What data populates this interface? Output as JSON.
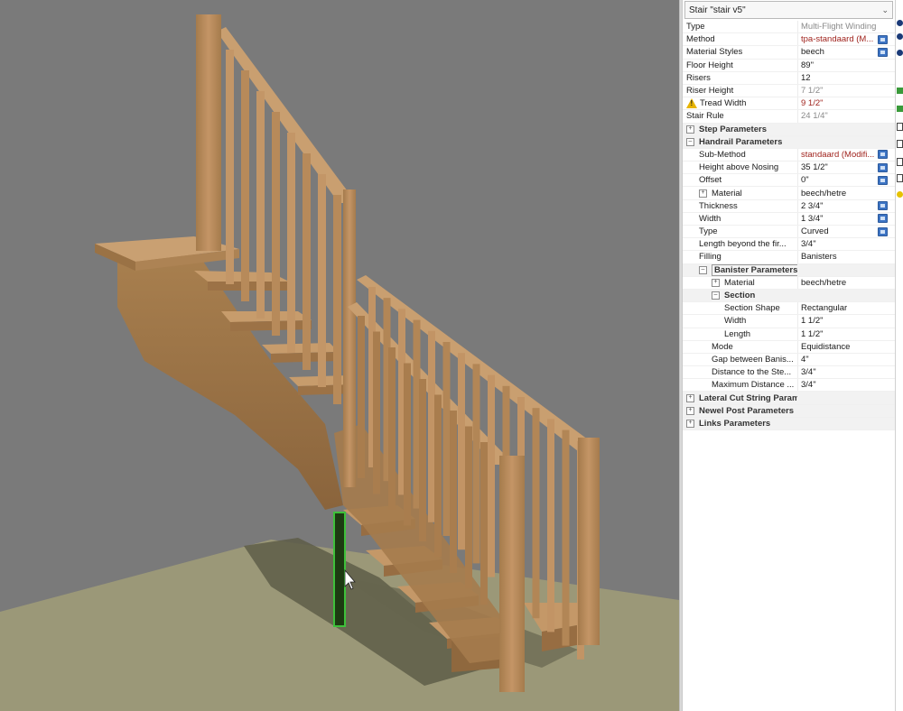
{
  "panel": {
    "header_title": "Stair \"stair v5\"",
    "rows": [
      {
        "name": "Type",
        "value": "Multi-Flight Winding",
        "indent": 0,
        "vstyle": "gray"
      },
      {
        "name": "Method",
        "value": "tpa-standaard (M...",
        "indent": 0,
        "vstyle": "red",
        "button": true
      },
      {
        "name": "Material Styles",
        "value": "beech",
        "indent": 0,
        "button": true
      },
      {
        "name": "Floor Height",
        "value": "89\"",
        "indent": 0
      },
      {
        "name": "Risers",
        "value": "12",
        "indent": 0
      },
      {
        "name": "Riser Height",
        "value": "7 1/2\"",
        "indent": 0,
        "vstyle": "gray"
      },
      {
        "name": "Tread Width",
        "value": "9 1/2\"",
        "indent": 0,
        "vstyle": "red",
        "warning": true
      },
      {
        "name": "Stair Rule",
        "value": "24 1/4\"",
        "indent": 0,
        "vstyle": "gray"
      },
      {
        "name": "Step Parameters",
        "indent": 0,
        "section": true,
        "expander": "+"
      },
      {
        "name": "Handrail Parameters",
        "indent": 0,
        "section": true,
        "expander": "−"
      },
      {
        "name": "Sub-Method",
        "value": "standaard (Modifi...",
        "indent": 1,
        "vstyle": "red",
        "button": true
      },
      {
        "name": "Height above Nosing",
        "value": "35 1/2\"",
        "indent": 1,
        "button": true
      },
      {
        "name": "Offset",
        "value": "0\"",
        "indent": 1,
        "button": true
      },
      {
        "name": "Material",
        "value": "beech/hetre",
        "indent": 1,
        "expander": "+"
      },
      {
        "name": "Thickness",
        "value": "2 3/4\"",
        "indent": 1,
        "button": true
      },
      {
        "name": "Width",
        "value": "1 3/4\"",
        "indent": 1,
        "button": true
      },
      {
        "name": "Type",
        "value": "Curved",
        "indent": 1,
        "button": true
      },
      {
        "name": "Length beyond the fir...",
        "value": "3/4\"",
        "indent": 1
      },
      {
        "name": "Filling",
        "value": "Banisters",
        "indent": 1
      },
      {
        "name": "Banister Parameters",
        "indent": 1,
        "expander": "−",
        "boxed": true,
        "section": true
      },
      {
        "name": "Material",
        "value": "beech/hetre",
        "indent": 2,
        "expander": "+"
      },
      {
        "name": "Section",
        "indent": 2,
        "expander": "−",
        "section": true
      },
      {
        "name": "Section Shape",
        "value": "Rectangular",
        "indent": 3
      },
      {
        "name": "Width",
        "value": "1 1/2\"",
        "indent": 3
      },
      {
        "name": "Length",
        "value": "1 1/2\"",
        "indent": 3
      },
      {
        "name": "Mode",
        "value": "Equidistance",
        "indent": 2
      },
      {
        "name": "Gap between Banis...",
        "value": "4\"",
        "indent": 2
      },
      {
        "name": "Distance to the Ste...",
        "value": "3/4\"",
        "indent": 2
      },
      {
        "name": "Maximum Distance ...",
        "value": "3/4\"",
        "indent": 2
      },
      {
        "name": "Lateral Cut String Parameters",
        "indent": 0,
        "section": true,
        "expander": "+"
      },
      {
        "name": "Newel Post Parameters",
        "indent": 0,
        "section": true,
        "expander": "+"
      },
      {
        "name": "Links Parameters",
        "indent": 0,
        "section": true,
        "expander": "+"
      }
    ]
  },
  "colors": {
    "viewport_bg": "#7a7a7a",
    "floor": "#9a9878",
    "wood": "#b98c5c",
    "wood_dark": "#8e6840",
    "wood_light": "#d2a97a",
    "selection": "#3ec03a",
    "button": "#3d74c4",
    "red_value": "#a0241e"
  }
}
